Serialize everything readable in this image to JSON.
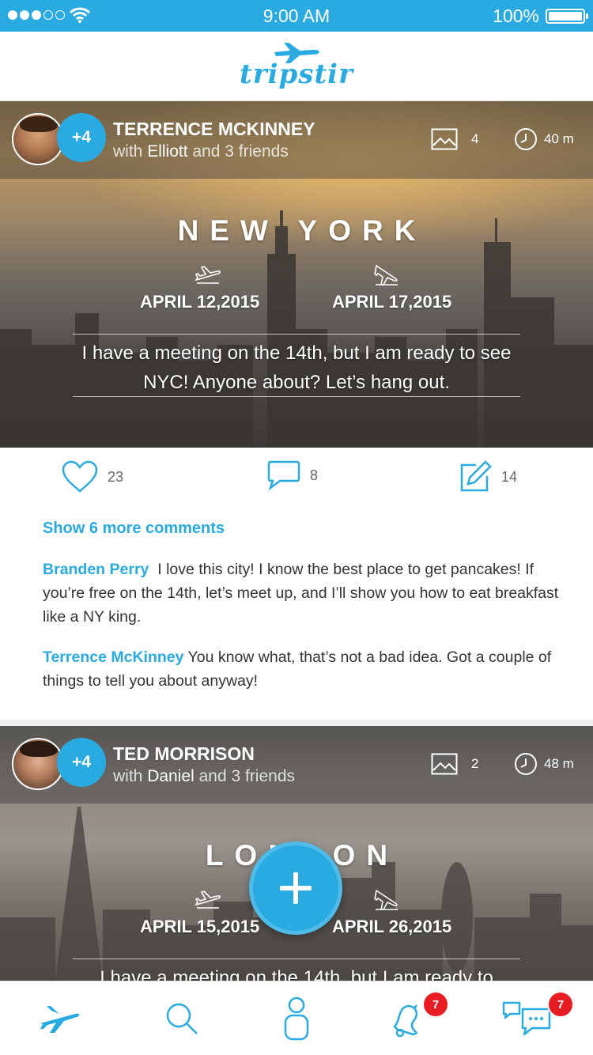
{
  "status_bar": {
    "time": "9:00 AM",
    "battery": "100%",
    "signal_icon": "signal-dots-icon",
    "wifi_icon": "wifi-icon",
    "battery_icon": "battery-icon"
  },
  "header": {
    "logo": "tripstir",
    "logo_icon": "plane-icon"
  },
  "colors": {
    "brand": "#29abe2",
    "badge": "#e81d24"
  },
  "posts": [
    {
      "user": "TERRENCE MCKINNEY",
      "plus_count": "+4",
      "with_prefix": "with",
      "with_name": "Elliott",
      "with_suffix": "and 3 friends",
      "photos": "4",
      "duration": "40 m",
      "city": "NEW YORK",
      "date_from": "APRIL 12,2015",
      "date_to": "APRIL 17,2015",
      "message": "I have a meeting on the 14th, but I am ready to see NYC! Anyone about? Let’s hang out.",
      "likes": "23",
      "comments_count": "8",
      "edits": "14",
      "show_more": "Show 6 more comments",
      "comments": [
        {
          "author": "Branden Perry",
          "text": "I love this city! I know the best place to get pancakes! If you’re free on the 14th, let’s meet up, and I’ll show you how to eat breakfast like a NY king."
        },
        {
          "author": "Terrence McKinney",
          "text": "You know what, that’s not a bad idea. Got a couple of things to tell you about anyway!"
        }
      ]
    },
    {
      "user": "TED MORRISON",
      "plus_count": "+4",
      "with_prefix": "with",
      "with_name": "Daniel",
      "with_suffix": "and 3 friends",
      "photos": "2",
      "duration": "48 m",
      "city": "LONDON",
      "date_from": "APRIL 15,2015",
      "date_to": "APRIL 26,2015",
      "message": "I have a meeting on the 14th, but I am ready to"
    }
  ],
  "tab_bar": {
    "items": [
      {
        "name": "trips",
        "icon": "plane-icon"
      },
      {
        "name": "search",
        "icon": "search-icon"
      },
      {
        "name": "profile",
        "icon": "person-icon"
      },
      {
        "name": "notifications",
        "icon": "bell-icon",
        "badge": "7"
      },
      {
        "name": "messages",
        "icon": "chat-icon",
        "badge": "7"
      }
    ]
  },
  "fab": {
    "icon": "plus-icon"
  }
}
